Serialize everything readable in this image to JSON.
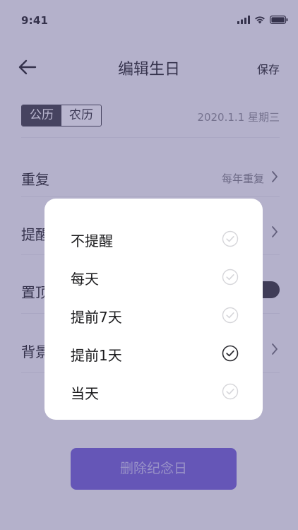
{
  "status_bar": {
    "time": "9:41"
  },
  "nav": {
    "title": "编辑生日",
    "save_label": "保存"
  },
  "calendar": {
    "options": [
      "公历",
      "农历"
    ],
    "selected": "公历",
    "date_value": "2020.1.1 星期三"
  },
  "settings": {
    "repeat": {
      "label": "重复",
      "value": "每年重复"
    },
    "reminder": {
      "label": "提醒"
    },
    "pin": {
      "label": "置顶",
      "enabled": true
    },
    "background": {
      "label": "背景"
    }
  },
  "delete_label": "删除纪念日",
  "reminder_popup": {
    "options": [
      {
        "label": "不提醒",
        "selected": false
      },
      {
        "label": "每天",
        "selected": false
      },
      {
        "label": "提前7天",
        "selected": false
      },
      {
        "label": "提前1天",
        "selected": true
      },
      {
        "label": "当天",
        "selected": false
      }
    ]
  },
  "colors": {
    "accent": "#6e5ad6",
    "overlay": "#58508c",
    "text_primary": "#1c1c1e",
    "text_secondary": "#8a8a90"
  },
  "icons": {
    "back": "arrow-left-icon",
    "chevron": "chevron-right-icon",
    "check": "check-circle-icon",
    "signal": "cellular-signal-icon",
    "wifi": "wifi-icon",
    "battery": "battery-icon"
  }
}
